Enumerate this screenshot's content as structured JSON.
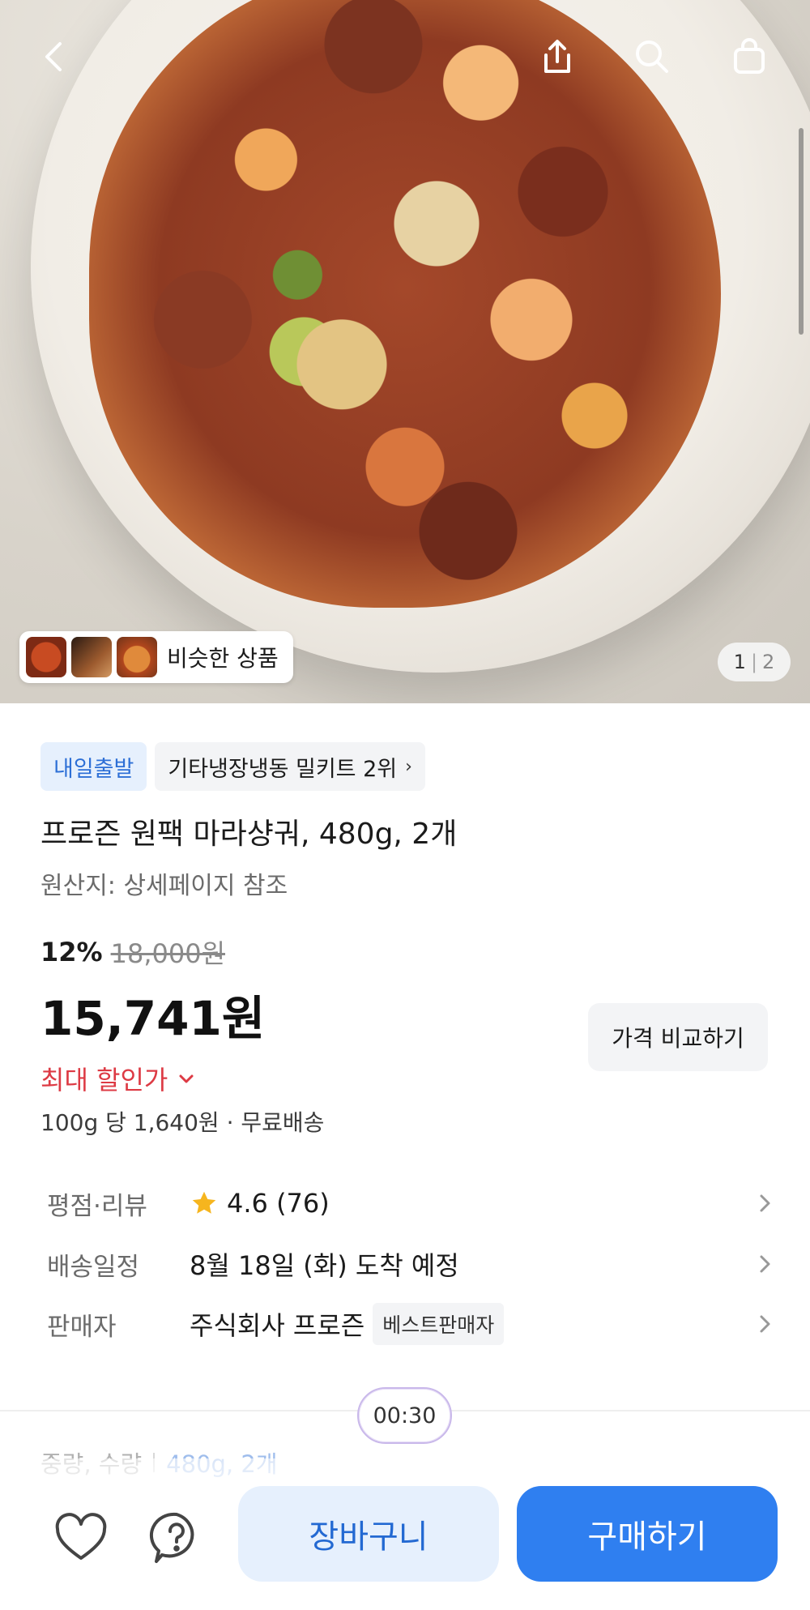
{
  "gallery": {
    "similar_label": "비슷한 상품",
    "pager_current": "1",
    "pager_total": "2"
  },
  "tags": {
    "delivery_badge": "내일출발",
    "ranking": "기타냉장냉동 밀키트 2위"
  },
  "product": {
    "title": "프로즌 원팩 마라샹궈, 480g, 2개",
    "origin": "원산지: 상세페이지 참조",
    "discount_percent": "12%",
    "original_price": "18,000원",
    "price": "15,741원",
    "compare_button": "가격 비교하기",
    "max_discount_label": "최대 할인가",
    "unit_price": "100g 당 1,640원 · 무료배송"
  },
  "info": {
    "rating_label": "평점·리뷰",
    "rating_value": "4.6 (76)",
    "delivery_label": "배송일정",
    "delivery_value": "8월 18일 (화) 도착 예정",
    "seller_label": "판매자",
    "seller_value": "주식회사 프로즌",
    "seller_badge": "베스트판매자"
  },
  "timer": "00:30",
  "weight": {
    "label": "중량, 수량",
    "value": "480g, 2개"
  },
  "actions": {
    "cart": "장바구니",
    "buy": "구매하기"
  },
  "icons": {
    "back": "back-icon",
    "share": "share-icon",
    "search": "search-icon",
    "bag": "shopping-bag-icon",
    "wishlist": "heart-icon",
    "inquiry": "question-icon",
    "star": "star-icon",
    "chevron": "chevron-right-icon"
  },
  "colors": {
    "accent_blue": "#2f7ff0",
    "discount_red": "#dd3a44",
    "star_yellow": "#f6b51e"
  }
}
